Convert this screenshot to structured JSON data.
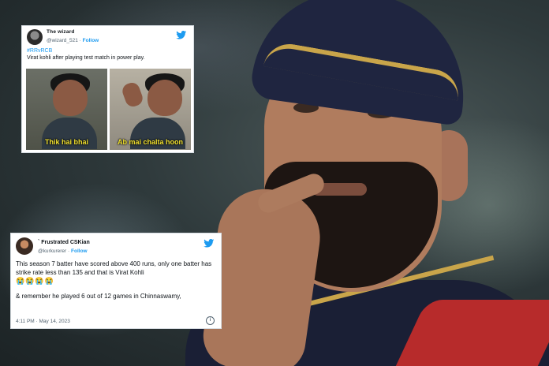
{
  "colors": {
    "link": "#1d9bf0",
    "caption": "#f2e230",
    "text": "#0f1419",
    "muted": "#536471"
  },
  "tweet1": {
    "name": "The wizard",
    "handle": "@wizard_521",
    "separator": "·",
    "follow": "Follow",
    "hashtag": "#RRvRCB",
    "text": "Virat kohli after playing test match in power play.",
    "memes": [
      {
        "caption": "Thik hai bhai"
      },
      {
        "caption": "Ab mai chalta hoon"
      }
    ]
  },
  "tweet2": {
    "name": "` Frustrated CSKian",
    "handle": "@kurkurerer",
    "separator": "·",
    "follow": "Follow",
    "text": "This season 7 batter have scored above 400 runs, only one batter has strike rate less than 135 and that is Virat Kohli",
    "emojis": "😭😭😭😭",
    "text2": "& remember he played 6 out of 12 games in Chinnaswamy,",
    "timestamp": "4:11 PM · May 14, 2023"
  },
  "icons": {
    "brand": "twitter-bird-icon",
    "info": "info-icon"
  }
}
